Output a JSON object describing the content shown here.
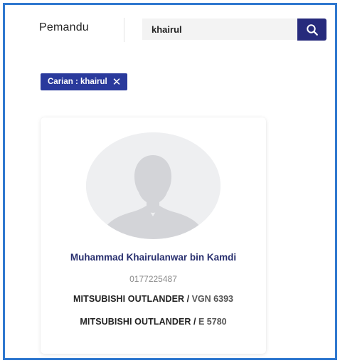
{
  "header": {
    "title": "Pemandu"
  },
  "search": {
    "value": "khairul"
  },
  "filter_chip": {
    "label": "Carian : khairul",
    "close_glyph": "✕"
  },
  "drivers": [
    {
      "name": "Muhammad Khairulanwar bin Kamdi",
      "phone": "0177225487",
      "avatar_icon": "person-placeholder-icon",
      "vehicles": [
        {
          "model": "MITSUBISHI OUTLANDER",
          "separator": " / ",
          "plate": "VGN 6393"
        },
        {
          "model": "MITSUBISHI OUTLANDER",
          "separator": " / ",
          "plate": "E 5780"
        }
      ]
    }
  ],
  "colors": {
    "frame_border": "#2f78cf",
    "search_button_bg": "#262a7c",
    "chip_bg": "#2a3a9c",
    "name_text": "#29306f",
    "avatar_bg": "#eeeff1",
    "avatar_figure": "#d3d4d8"
  }
}
